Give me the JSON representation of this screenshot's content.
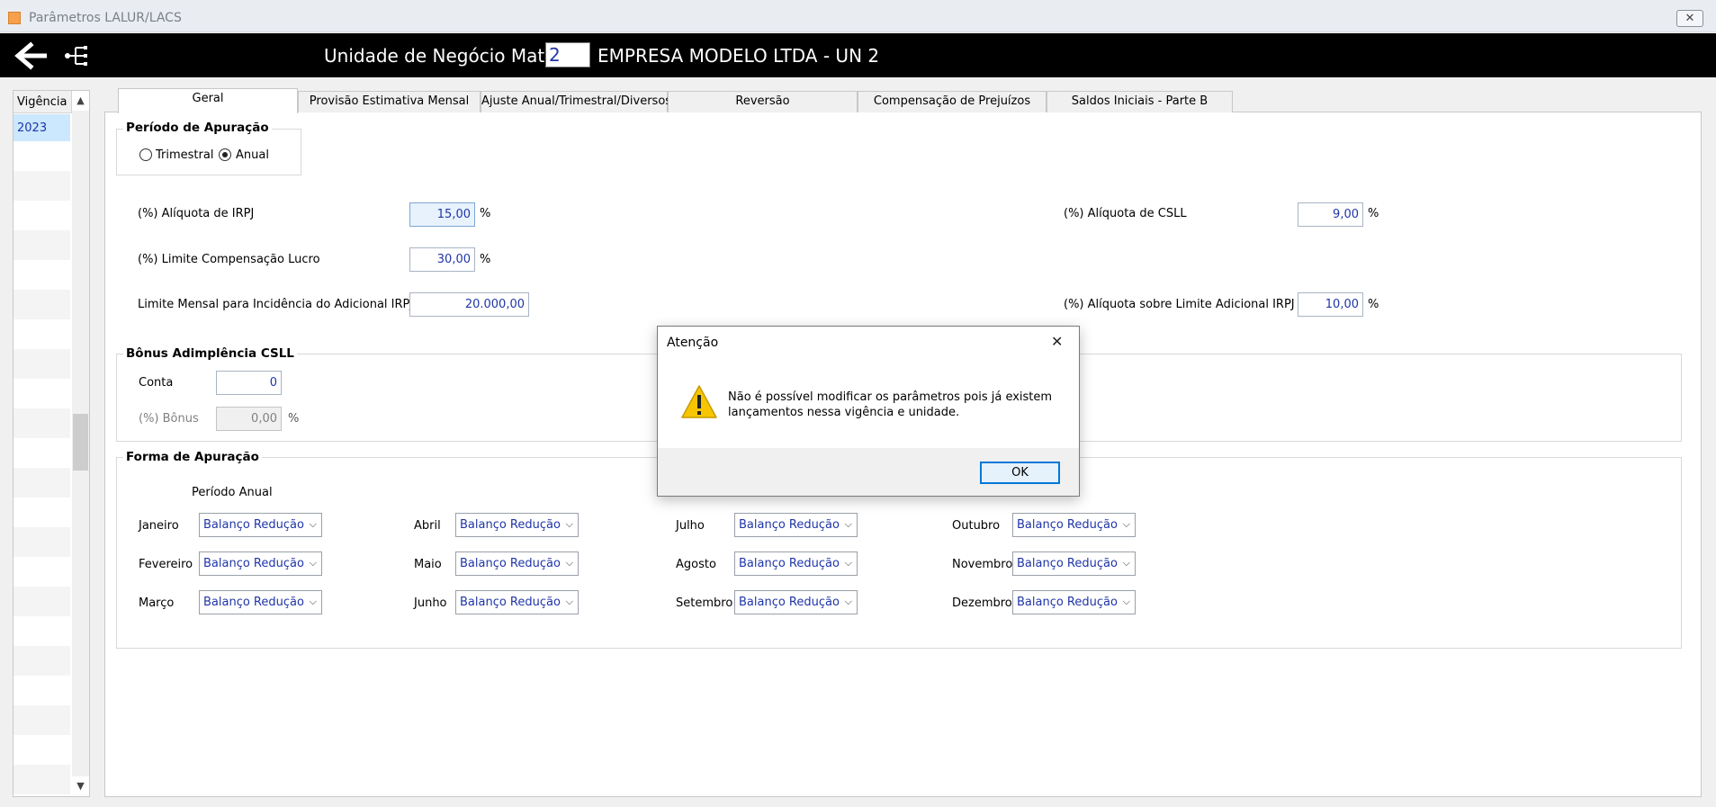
{
  "window": {
    "title": "Parâmetros LALUR/LACS"
  },
  "header": {
    "unit_label": "Unidade de Negócio Matriz",
    "unit_value": "2",
    "company": "EMPRESA MODELO LTDA - UN 2"
  },
  "vigencia": {
    "header": "Vigência",
    "items": [
      "2023"
    ]
  },
  "tabs": [
    {
      "label": "Geral",
      "active": true
    },
    {
      "label": "Provisão Estimativa Mensal"
    },
    {
      "label": "Ajuste Anual/Trimestral/Diversos"
    },
    {
      "label": "Reversão"
    },
    {
      "label": "Compensação de Prejuízos"
    },
    {
      "label": "Saldos Iniciais - Parte B"
    }
  ],
  "periodo": {
    "title": "Período de Apuração",
    "options": [
      {
        "label": "Trimestral",
        "checked": false
      },
      {
        "label": "Anual",
        "checked": true
      }
    ]
  },
  "fields": {
    "aliquota_irpj_label": "(%) Alíquota de IRPJ",
    "aliquota_irpj_value": "15,00",
    "limite_comp_label": "(%) Limite Compensação Lucro",
    "limite_comp_value": "30,00",
    "limite_mensal_label": "Limite Mensal para Incidência do Adicional IRPJ",
    "limite_mensal_value": "20.000,00",
    "aliquota_csll_label": "(%) Alíquota de CSLL",
    "aliquota_csll_value": "9,00",
    "aliquota_adicional_label": "(%) Alíquota sobre Limite Adicional IRPJ",
    "aliquota_adicional_value": "10,00",
    "pct": "%"
  },
  "bonus": {
    "title": "Bônus Adimplência CSLL",
    "conta_label": "Conta",
    "conta_value": "0",
    "bonus_label": "(%) Bônus",
    "bonus_value": "0,00"
  },
  "forma": {
    "title": "Forma de Apuração",
    "subtitle": "Período Anual",
    "months": [
      {
        "label": "Janeiro",
        "value": "Balanço Redução"
      },
      {
        "label": "Fevereiro",
        "value": "Balanço Redução"
      },
      {
        "label": "Março",
        "value": "Balanço Redução"
      },
      {
        "label": "Abril",
        "value": "Balanço Redução"
      },
      {
        "label": "Maio",
        "value": "Balanço Redução"
      },
      {
        "label": "Junho",
        "value": "Balanço Redução"
      },
      {
        "label": "Julho",
        "value": "Balanço Redução"
      },
      {
        "label": "Agosto",
        "value": "Balanço Redução"
      },
      {
        "label": "Setembro",
        "value": "Balanço Redução"
      },
      {
        "label": "Outubro",
        "value": "Balanço Redução"
      },
      {
        "label": "Novembro",
        "value": "Balanço Redução"
      },
      {
        "label": "Dezembro",
        "value": "Balanço Redução"
      }
    ]
  },
  "dialog": {
    "title": "Atenção",
    "message_line1": "Não é possível modificar os parâmetros pois já existem",
    "message_line2": "lançamentos nessa vigência e unidade.",
    "ok": "OK"
  },
  "icons": {
    "back": "back-arrow-icon",
    "tree": "tree-network-icon",
    "warning": "warning-icon",
    "close": "close-icon",
    "chevron": "chevron-down-icon"
  },
  "colors": {
    "value_text": "#1f35a8",
    "header_bg": "#000000",
    "selected_row": "#cce8ff",
    "ok_border": "#0078d7"
  }
}
